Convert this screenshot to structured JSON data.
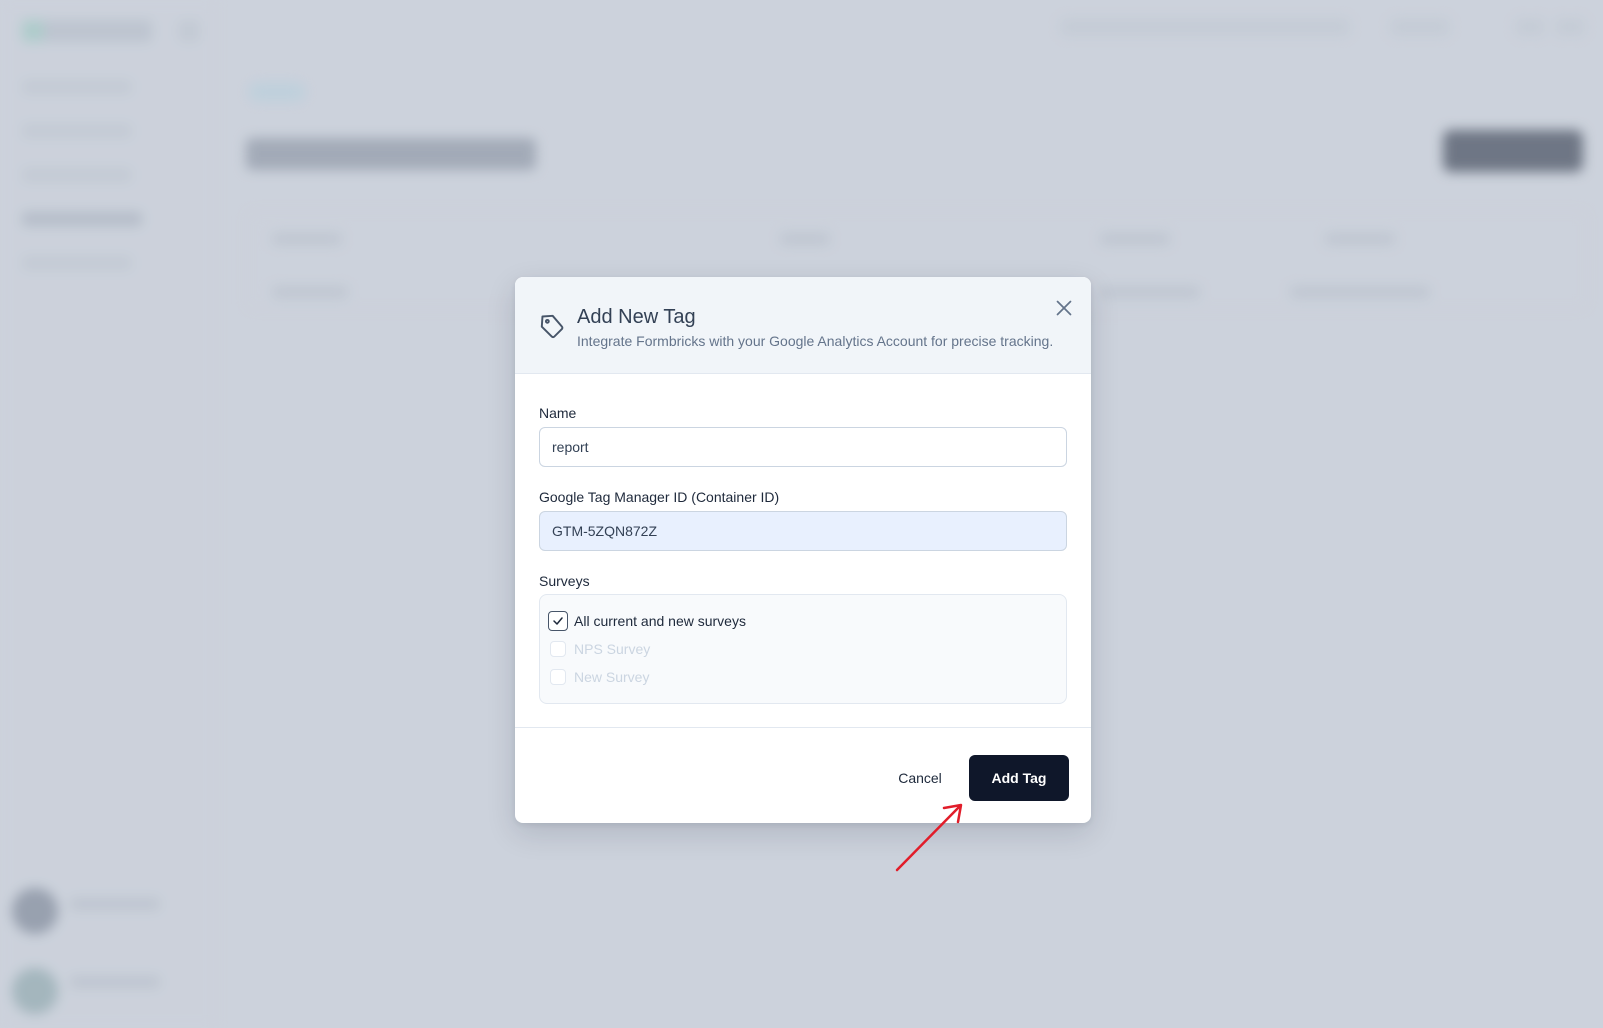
{
  "modal": {
    "title": "Add New Tag",
    "subtitle": "Integrate Formbricks with your Google Analytics Account for precise tracking.",
    "close_icon": "close-icon",
    "header_icon": "tag-icon"
  },
  "form": {
    "name_label": "Name",
    "name_value": "report",
    "gtm_label": "Google Tag Manager ID (Container ID)",
    "gtm_value": "GTM-5ZQN872Z",
    "surveys_label": "Surveys",
    "surveys": [
      {
        "label": "All current and new surveys",
        "checked": true,
        "disabled": false
      },
      {
        "label": "NPS Survey",
        "checked": false,
        "disabled": true
      },
      {
        "label": "New Survey",
        "checked": false,
        "disabled": true
      }
    ]
  },
  "footer": {
    "cancel_label": "Cancel",
    "add_label": "Add Tag"
  },
  "colors": {
    "primary_button": "#0f172a",
    "annotation_arrow": "#e11d2a",
    "overlay": "#cdd3dc",
    "autofill_input": "#e8f0fe"
  }
}
